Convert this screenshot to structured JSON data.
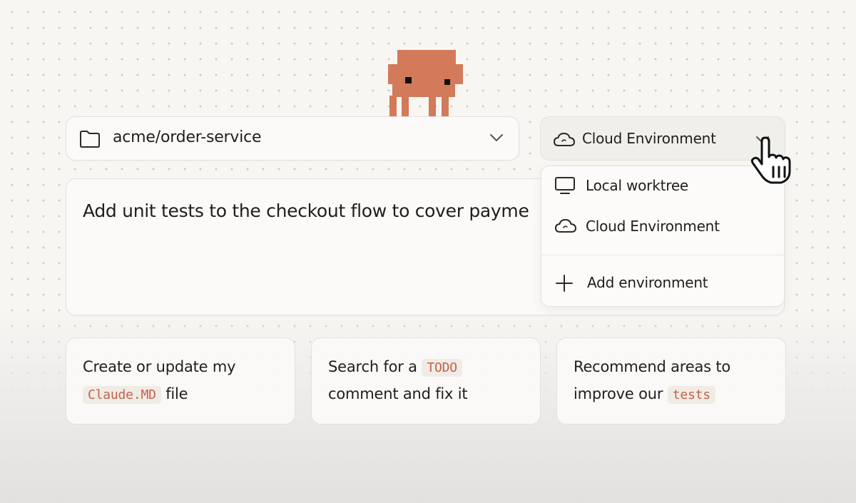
{
  "repo_selector": {
    "value": "acme/order-service",
    "icon": "folder-icon"
  },
  "environment_selector": {
    "value": "Cloud Environment",
    "icon": "cloud-icon",
    "expanded": true
  },
  "environment_menu": {
    "items": [
      {
        "label": "Local worktree",
        "icon": "monitor-icon"
      },
      {
        "label": "Cloud Environment",
        "icon": "cloud-icon"
      }
    ],
    "add_label": "Add environment"
  },
  "prompt": {
    "text": "Add unit tests to the checkout flow to cover payme"
  },
  "suggestions": [
    {
      "line1_a": "Create or update my",
      "line2_code": "Claude.MD",
      "line2_b": " file"
    },
    {
      "line1_a": "Search for a ",
      "line1_code": "TODO",
      "line2_a": "comment and fix it"
    },
    {
      "line1_a": "Recommend areas to",
      "line2_a": "improve our ",
      "line2_code": "tests"
    }
  ],
  "colors": {
    "mascot": "#d27a5a",
    "code_text": "#c2624a",
    "background": "#f7f6f3"
  }
}
